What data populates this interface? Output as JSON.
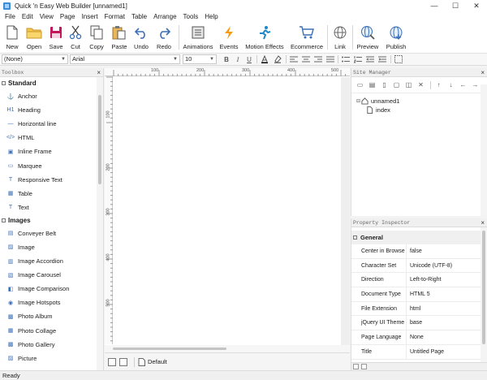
{
  "window": {
    "title": "Quick 'n Easy Web Builder [unnamed1]",
    "minimize": "—",
    "maximize": "☐",
    "close": "✕"
  },
  "menu": [
    "File",
    "Edit",
    "View",
    "Page",
    "Insert",
    "Format",
    "Table",
    "Arrange",
    "Tools",
    "Help"
  ],
  "toolbar": {
    "new": "New",
    "open": "Open",
    "save": "Save",
    "cut": "Cut",
    "copy": "Copy",
    "paste": "Paste",
    "undo": "Undo",
    "redo": "Redo",
    "animations": "Animations",
    "events": "Events",
    "motion_effects": "Motion Effects",
    "ecommerce": "Ecommerce",
    "link": "Link",
    "preview": "Preview",
    "publish": "Publish"
  },
  "formatbar": {
    "style": "(None)",
    "font": "Arial",
    "size": "10"
  },
  "toolbox": {
    "title": "Toolbox",
    "sections": [
      {
        "name": "Standard",
        "items": [
          {
            "label": "Anchor",
            "icon": "anchor-icon",
            "glyph": "⚓"
          },
          {
            "label": "Heading",
            "icon": "heading-icon",
            "glyph": "H1"
          },
          {
            "label": "Horizontal line",
            "icon": "horizontal-line-icon",
            "glyph": "—"
          },
          {
            "label": "HTML",
            "icon": "html-icon",
            "glyph": "</>"
          },
          {
            "label": "Inline Frame",
            "icon": "inline-frame-icon",
            "glyph": "▣"
          },
          {
            "label": "Marquee",
            "icon": "marquee-icon",
            "glyph": "▭"
          },
          {
            "label": "Responsive Text",
            "icon": "responsive-text-icon",
            "glyph": "T"
          },
          {
            "label": "Table",
            "icon": "table-icon",
            "glyph": "▦"
          },
          {
            "label": "Text",
            "icon": "text-icon",
            "glyph": "T"
          }
        ]
      },
      {
        "name": "Images",
        "items": [
          {
            "label": "Conveyer Belt",
            "icon": "conveyer-belt-icon",
            "glyph": "▤"
          },
          {
            "label": "Image",
            "icon": "image-icon",
            "glyph": "▨"
          },
          {
            "label": "Image Accordion",
            "icon": "image-accordion-icon",
            "glyph": "▥"
          },
          {
            "label": "Image Carousel",
            "icon": "image-carousel-icon",
            "glyph": "▧"
          },
          {
            "label": "Image Comparison",
            "icon": "image-comparison-icon",
            "glyph": "◧"
          },
          {
            "label": "Image Hotspots",
            "icon": "image-hotspots-icon",
            "glyph": "◉"
          },
          {
            "label": "Photo Album",
            "icon": "photo-album-icon",
            "glyph": "▩"
          },
          {
            "label": "Photo Collage",
            "icon": "photo-collage-icon",
            "glyph": "▦"
          },
          {
            "label": "Photo Gallery",
            "icon": "photo-gallery-icon",
            "glyph": "▩"
          },
          {
            "label": "Picture",
            "icon": "picture-icon",
            "glyph": "▨"
          }
        ]
      }
    ]
  },
  "canvas": {
    "hruler": [
      "100",
      "200",
      "300",
      "400",
      "500"
    ],
    "vruler": [
      "100",
      "200",
      "300",
      "400",
      "500"
    ],
    "page_tab": "Default"
  },
  "site_manager": {
    "title": "Site Manager",
    "root": "unnamed1",
    "child": "index"
  },
  "property_inspector": {
    "title": "Property Inspector",
    "section": "General",
    "rows": [
      {
        "name": "Center in Browse",
        "value": "false"
      },
      {
        "name": "Character Set",
        "value": "Unicode (UTF-8)"
      },
      {
        "name": "Direction",
        "value": "Left-to-Right"
      },
      {
        "name": "Document Type",
        "value": "HTML 5"
      },
      {
        "name": "File Extension",
        "value": "html"
      },
      {
        "name": "jQuery UI Theme",
        "value": "base"
      },
      {
        "name": "Page Language",
        "value": "None"
      },
      {
        "name": "Title",
        "value": "Untitled Page"
      }
    ]
  },
  "status": "Ready",
  "colors": {
    "accent": "#3b6fb6",
    "save_icon": "#c2185b",
    "events_icon": "#f39c12",
    "motion_icon": "#1e88c8"
  }
}
